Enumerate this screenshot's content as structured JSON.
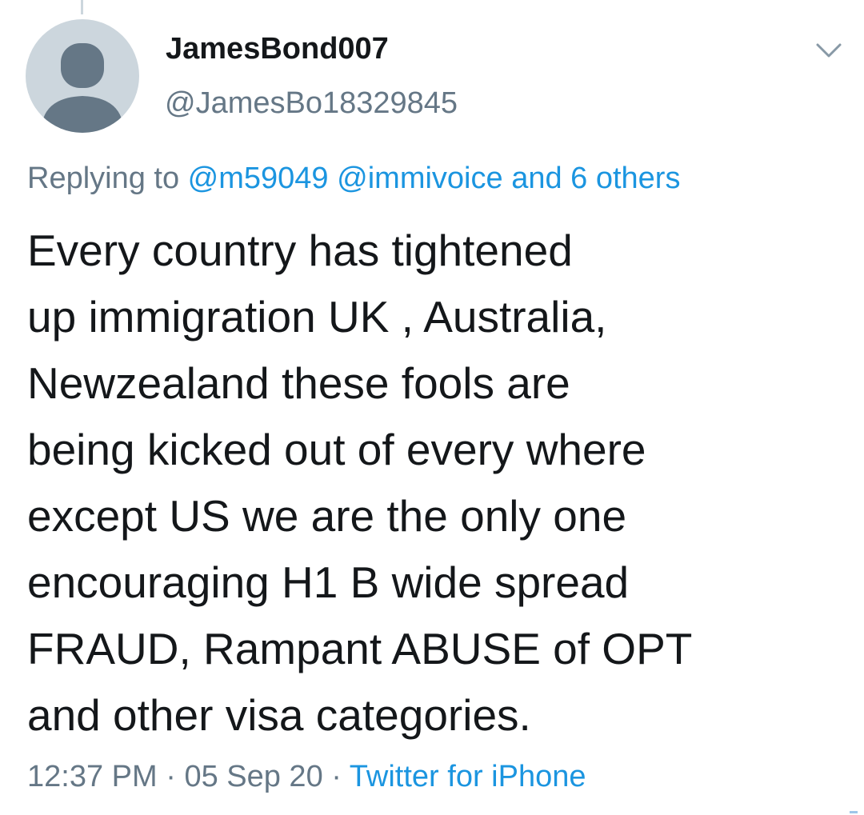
{
  "tweet": {
    "author": {
      "display_name": "JamesBond007",
      "handle": "@JamesBo18329845",
      "avatar_icon": "default-user-avatar-icon"
    },
    "reply": {
      "prefix": "Replying to ",
      "mentions": [
        "@m59049",
        "@immivoice"
      ],
      "others": "and 6 others"
    },
    "text_lines": [
      "Every country has tightened",
      "up immigration UK , Australia,",
      "Newzealand these fools are",
      "being kicked out of every where",
      "except US we are the only one",
      "encouraging H1 B wide spread",
      "FRAUD, Rampant ABUSE of OPT",
      "and other visa categories."
    ],
    "meta": {
      "time": "12:37 PM",
      "separator": " · ",
      "date": "05 Sep 20",
      "source": "Twitter for iPhone"
    },
    "menu_icon": "chevron-down-icon"
  },
  "colors": {
    "text": "#14171a",
    "secondary": "#657786",
    "link": "#1b95e0",
    "avatar_bg": "#ccd6dd",
    "avatar_fg": "#657786"
  }
}
